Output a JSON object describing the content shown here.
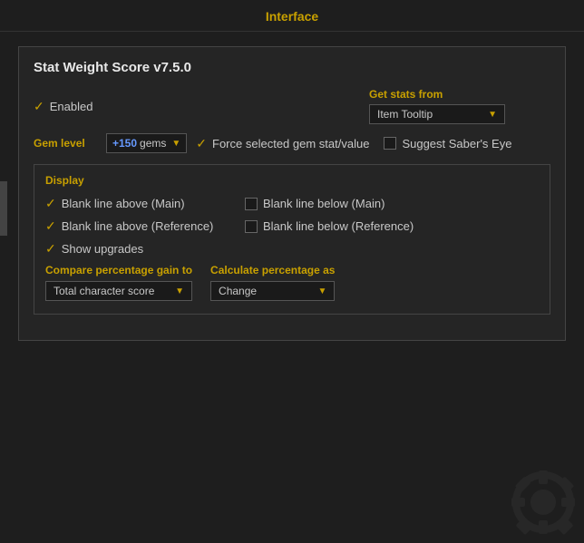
{
  "header": {
    "title": "Interface"
  },
  "panel": {
    "title": "Stat Weight Score v7.5.0",
    "enabled_label": "Enabled",
    "get_stats_from_label": "Get stats from",
    "get_stats_from_value": "Item Tooltip",
    "gem_level_label": "Gem level",
    "gem_level_value": "+150",
    "gem_level_suffix": "gems",
    "force_gem_label": "Force selected gem stat/value",
    "suggest_sabers_eye_label": "Suggest Saber's Eye",
    "display_section_title": "Display",
    "checkboxes": [
      {
        "label": "Blank line above (Main)",
        "checked": true
      },
      {
        "label": "Blank line below (Main)",
        "checked": false
      },
      {
        "label": "Blank line above (Reference)",
        "checked": true
      },
      {
        "label": "Blank line below (Reference)",
        "checked": false
      },
      {
        "label": "Show upgrades",
        "checked": true
      }
    ],
    "compare_label": "Compare percentage gain to",
    "compare_value": "Total character score",
    "calculate_label": "Calculate percentage as",
    "calculate_value": "Change"
  }
}
